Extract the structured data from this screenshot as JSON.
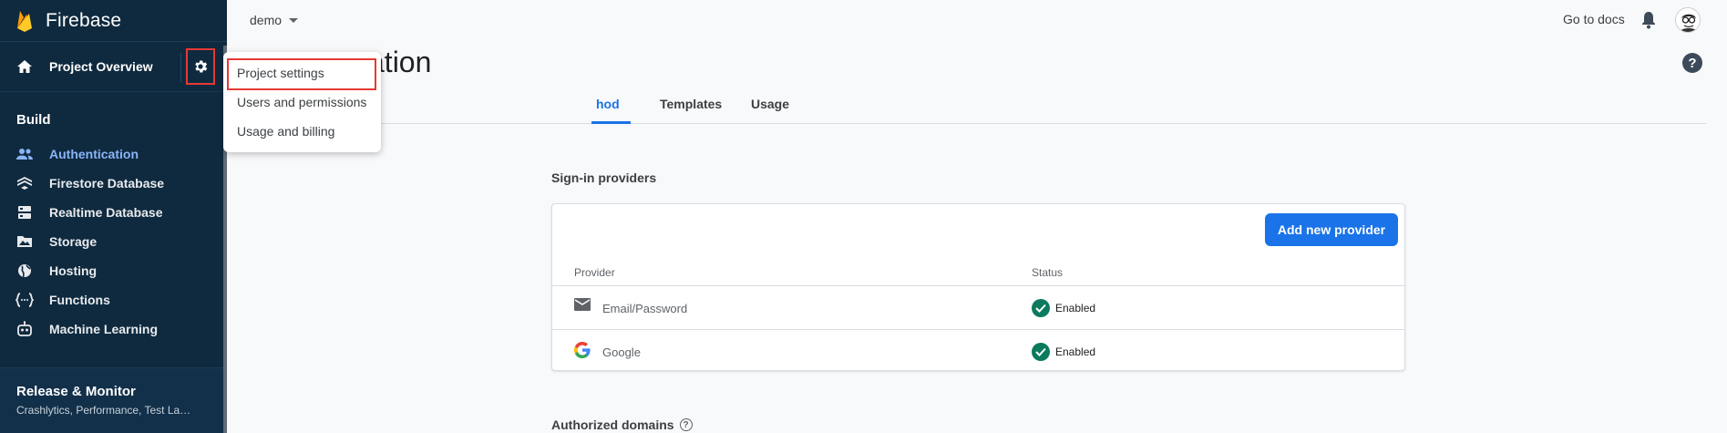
{
  "app": {
    "name": "Firebase"
  },
  "sidebar": {
    "overview_label": "Project Overview",
    "build_title": "Build",
    "items": [
      {
        "label": "Authentication",
        "icon": "people-icon"
      },
      {
        "label": "Firestore Database",
        "icon": "firestore-icon"
      },
      {
        "label": "Realtime Database",
        "icon": "database-icon"
      },
      {
        "label": "Storage",
        "icon": "storage-icon"
      },
      {
        "label": "Hosting",
        "icon": "globe-icon"
      },
      {
        "label": "Functions",
        "icon": "functions-icon"
      },
      {
        "label": "Machine Learning",
        "icon": "robot-icon"
      }
    ],
    "release_title": "Release & Monitor",
    "release_sub": "Crashlytics, Performance, Test La…"
  },
  "topbar": {
    "project": "demo",
    "docs_label": "Go to docs"
  },
  "page": {
    "title": "ation",
    "help_glyph": "?",
    "tabs": [
      "hod",
      "Templates",
      "Usage"
    ]
  },
  "providers": {
    "section_title": "Sign-in providers",
    "add_button": "Add new provider",
    "columns": [
      "Provider",
      "Status"
    ],
    "rows": [
      {
        "name": "Email/Password",
        "status": "Enabled",
        "icon": "mail-icon"
      },
      {
        "name": "Google",
        "status": "Enabled",
        "icon": "google-icon"
      }
    ]
  },
  "authorized_domains": {
    "title": "Authorized domains"
  },
  "menu": {
    "items": [
      "Project settings",
      "Users and permissions",
      "Usage and billing"
    ]
  },
  "colors": {
    "sidebar": "#0f2a3f",
    "accent": "#1a73e8",
    "highlight": "#e53935",
    "enabled": "#0b7a5d"
  }
}
